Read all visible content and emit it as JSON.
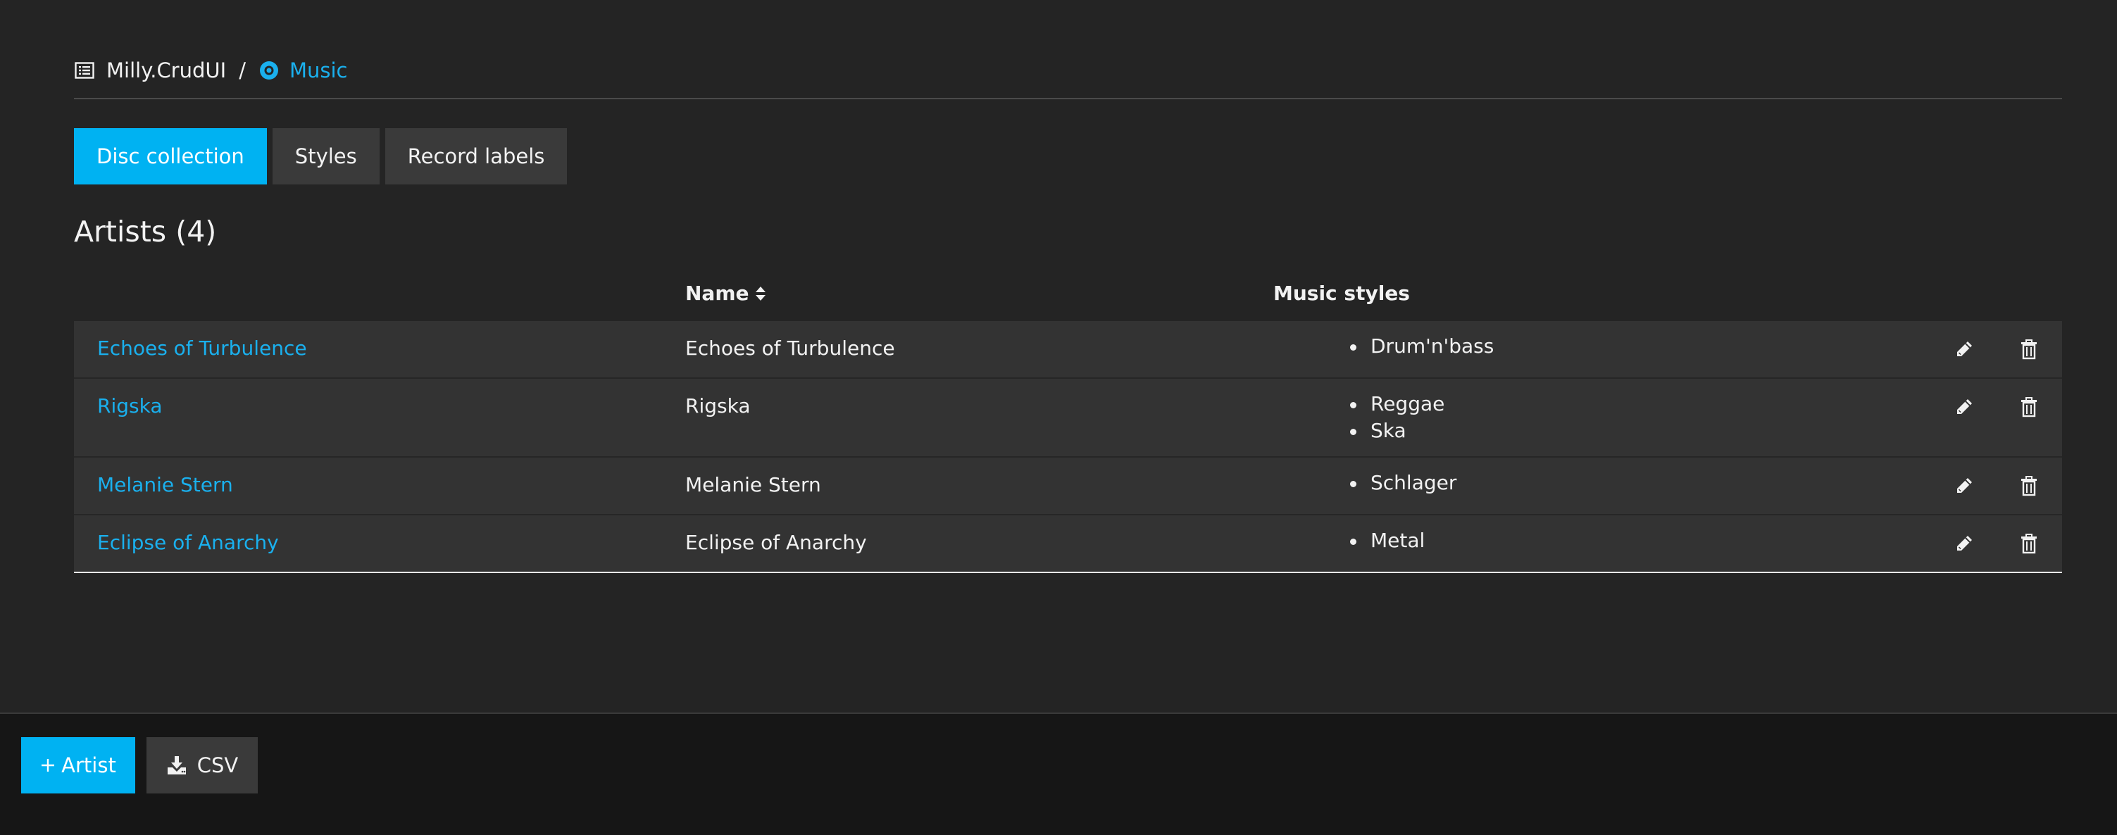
{
  "breadcrumb": {
    "home_label": "Milly.CrudUI",
    "separator": "/",
    "current_label": "Music"
  },
  "tabs": [
    {
      "label": "Disc collection",
      "active": true
    },
    {
      "label": "Styles",
      "active": false
    },
    {
      "label": "Record labels",
      "active": false
    }
  ],
  "section": {
    "title": "Artists (4)"
  },
  "table": {
    "columns": {
      "name": "Name",
      "music_styles": "Music styles"
    },
    "rows": [
      {
        "link": "Echoes of Turbulence",
        "name": "Echoes of Turbulence",
        "styles": [
          "Drum'n'bass"
        ]
      },
      {
        "link": "Rigska",
        "name": "Rigska",
        "styles": [
          "Reggae",
          "Ska"
        ]
      },
      {
        "link": "Melanie Stern",
        "name": "Melanie Stern",
        "styles": [
          "Schlager"
        ]
      },
      {
        "link": "Eclipse of Anarchy",
        "name": "Eclipse of Anarchy",
        "styles": [
          "Metal"
        ]
      }
    ]
  },
  "footer": {
    "add_label": "Artist",
    "csv_label": "CSV"
  },
  "icons": {
    "home": "list-icon",
    "music": "disc-icon",
    "sort": "sort-icon",
    "edit": "pencil-icon",
    "delete": "trash-icon",
    "add": "plus-icon",
    "download": "download-icon"
  },
  "colors": {
    "accent": "#00b2f2",
    "link": "#1ab0ee",
    "background": "#242424",
    "row": "#333333",
    "footer": "#161616"
  }
}
